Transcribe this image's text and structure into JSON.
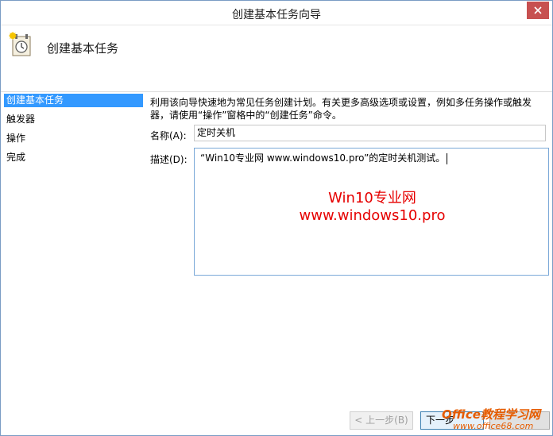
{
  "window": {
    "title": "创建基本任务向导"
  },
  "header": {
    "title": "创建基本任务",
    "icon": "task-scheduler-clock-icon"
  },
  "sidebar": {
    "items": [
      {
        "label": "创建基本任务",
        "active": true
      },
      {
        "label": "触发器",
        "active": false
      },
      {
        "label": "操作",
        "active": false
      },
      {
        "label": "完成",
        "active": false
      }
    ]
  },
  "main": {
    "description_line1": "利用该向导快速地为常见任务创建计划。有关更多高级选项或设置，例如多任务操作或触发",
    "description_line2": "器，请使用“操作”窗格中的“创建任务”命令。",
    "name_label": "名称(A):",
    "name_value": "定时关机",
    "desc_label": "描述(D):",
    "desc_value": "“Win10专业网 www.windows10.pro”的定时关机测试。",
    "watermark_line1": "Win10专业网",
    "watermark_line2": "www.windows10.pro"
  },
  "footer": {
    "back_label": "< 上一步(B)",
    "next_label": "下一步",
    "logo_line1": "Office教程学习网",
    "logo_line2": "www.office68.com"
  },
  "colors": {
    "accent": "#3399ff",
    "watermark": "#e60000",
    "close": "#c75050"
  }
}
